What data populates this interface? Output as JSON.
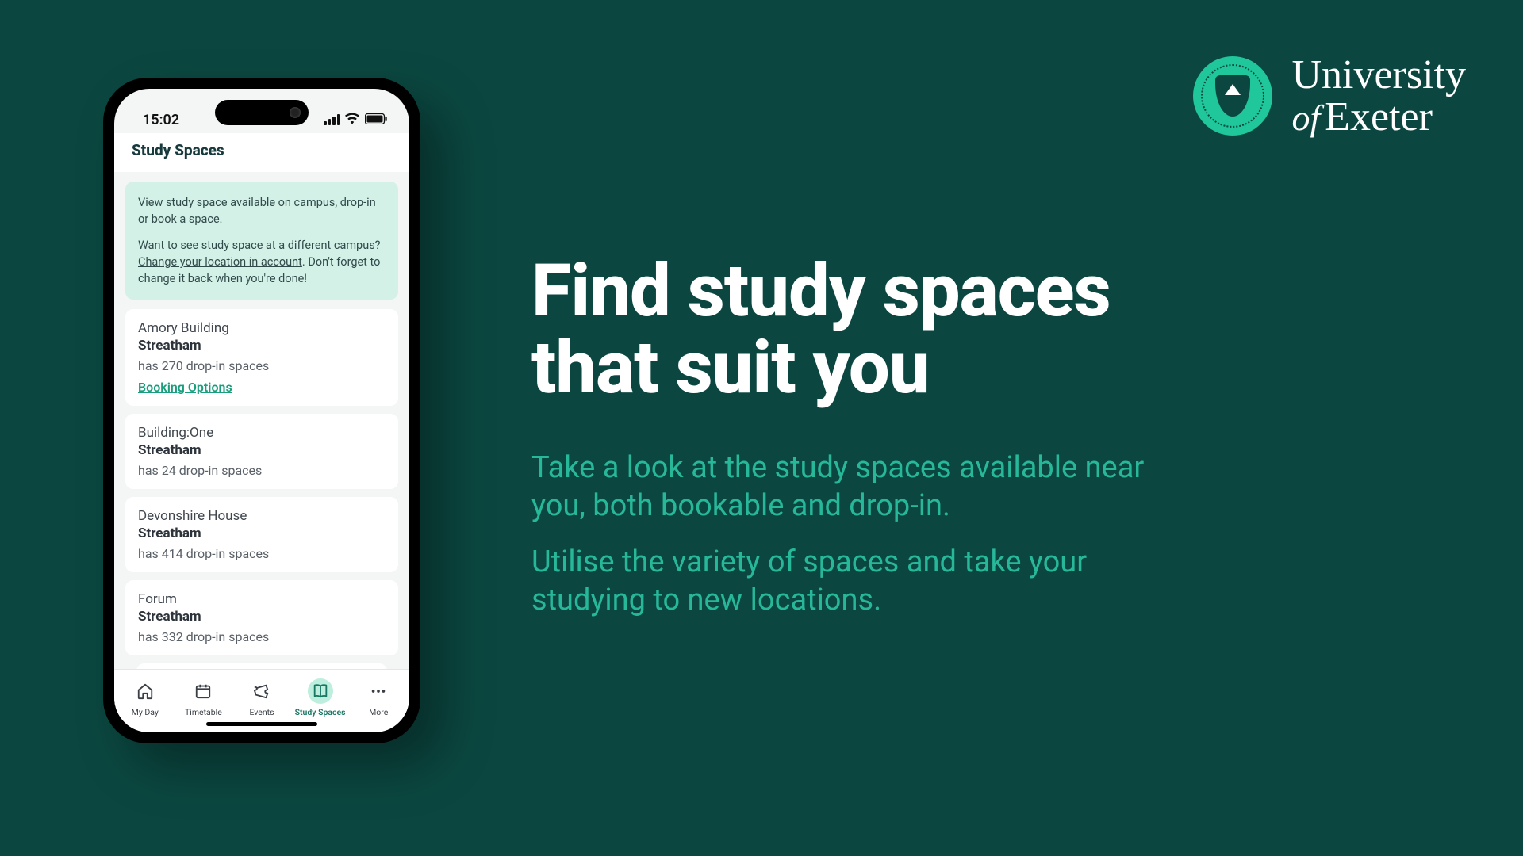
{
  "brand": {
    "line1": "University",
    "of": "of",
    "line2": "Exeter"
  },
  "hero": {
    "title_line1": "Find study spaces",
    "title_line2": "that suit you",
    "sub1": "Take a look at the study spaces available near you, both bookable and drop-in.",
    "sub2": "Utilise the variety of spaces and take your studying to new locations."
  },
  "phone": {
    "time": "15:02",
    "page_title": "Study Spaces",
    "info": {
      "p1": "View study space available on campus, drop-in or book a space.",
      "p2a": "Want to see study space at a different campus? ",
      "link": "Change your location in account",
      "p2b": ". Don't forget to change it back when you're done!"
    },
    "spaces": [
      {
        "name": "Amory Building",
        "campus": "Streatham",
        "count": "has 270 drop-in spaces",
        "booking": "Booking Options"
      },
      {
        "name": "Building:One",
        "campus": "Streatham",
        "count": "has 24 drop-in spaces"
      },
      {
        "name": "Devonshire House",
        "campus": "Streatham",
        "count": "has 414 drop-in spaces"
      },
      {
        "name": "Forum",
        "campus": "Streatham",
        "count": "has 332 drop-in spaces"
      }
    ],
    "nav": {
      "my_day": "My Day",
      "timetable": "Timetable",
      "events": "Events",
      "study_spaces": "Study Spaces",
      "more": "More"
    }
  }
}
